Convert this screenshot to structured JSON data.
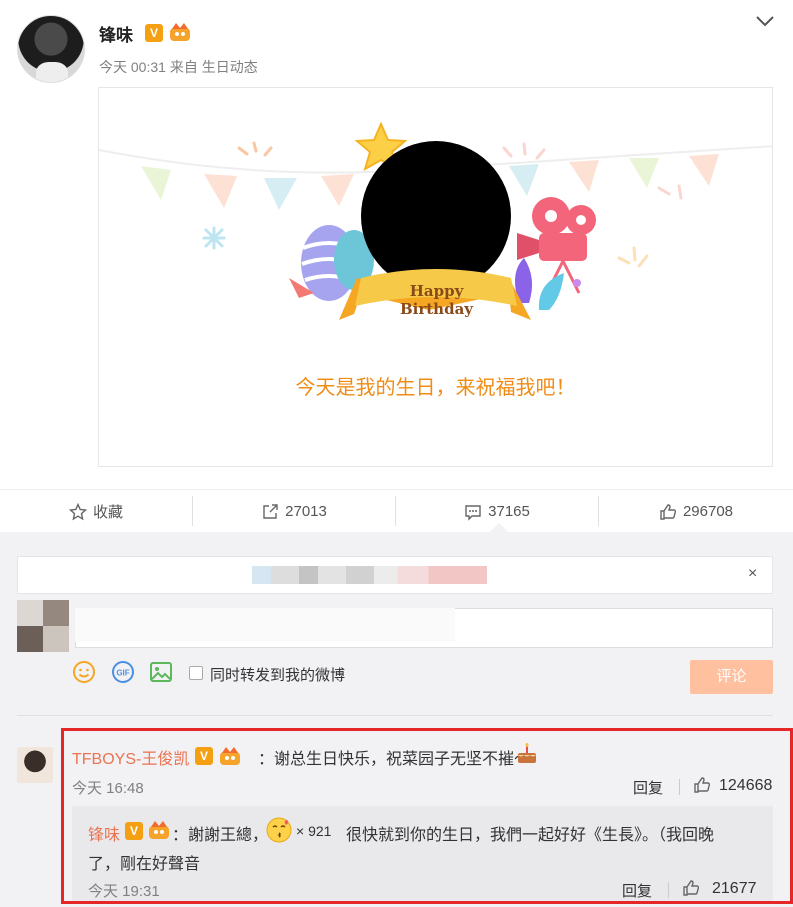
{
  "post": {
    "user_name": "锋味",
    "meta": "今天 00:31 来自 生日动态",
    "card_text": "今天是我的生日，来祝福我吧！",
    "card_banner": "Happy Birthday",
    "verified_badge": "V"
  },
  "actions": {
    "favorite_label": "收藏",
    "repost_count": "27013",
    "comment_count": "37165",
    "like_count": "296708"
  },
  "composer": {
    "sync_label": "同时转发到我的微博",
    "submit_label": "评论",
    "close_glyph": "×"
  },
  "comment": {
    "user_name": "TFBOYS-王俊凯",
    "text": "：谢总生日快乐，祝菜园子无坚不摧～",
    "time": "今天 16:48",
    "reply_label": "回复",
    "likes": "124668",
    "reply": {
      "user_name": "锋味",
      "text_part1": "：謝謝王總，",
      "multiplier": "× 921",
      "text_part2": "很快就到你的生日，我們一起好好《生長》。（我回晚",
      "text_part3": "了，剛在好聲音",
      "time": "今天 19:31",
      "reply_label": "回复",
      "likes": "21677"
    }
  },
  "colors": {
    "accent_orange": "#f08c16",
    "name_color": "#eb7350",
    "highlight_red": "#e52727",
    "submit_disabled": "#ffc09f"
  }
}
